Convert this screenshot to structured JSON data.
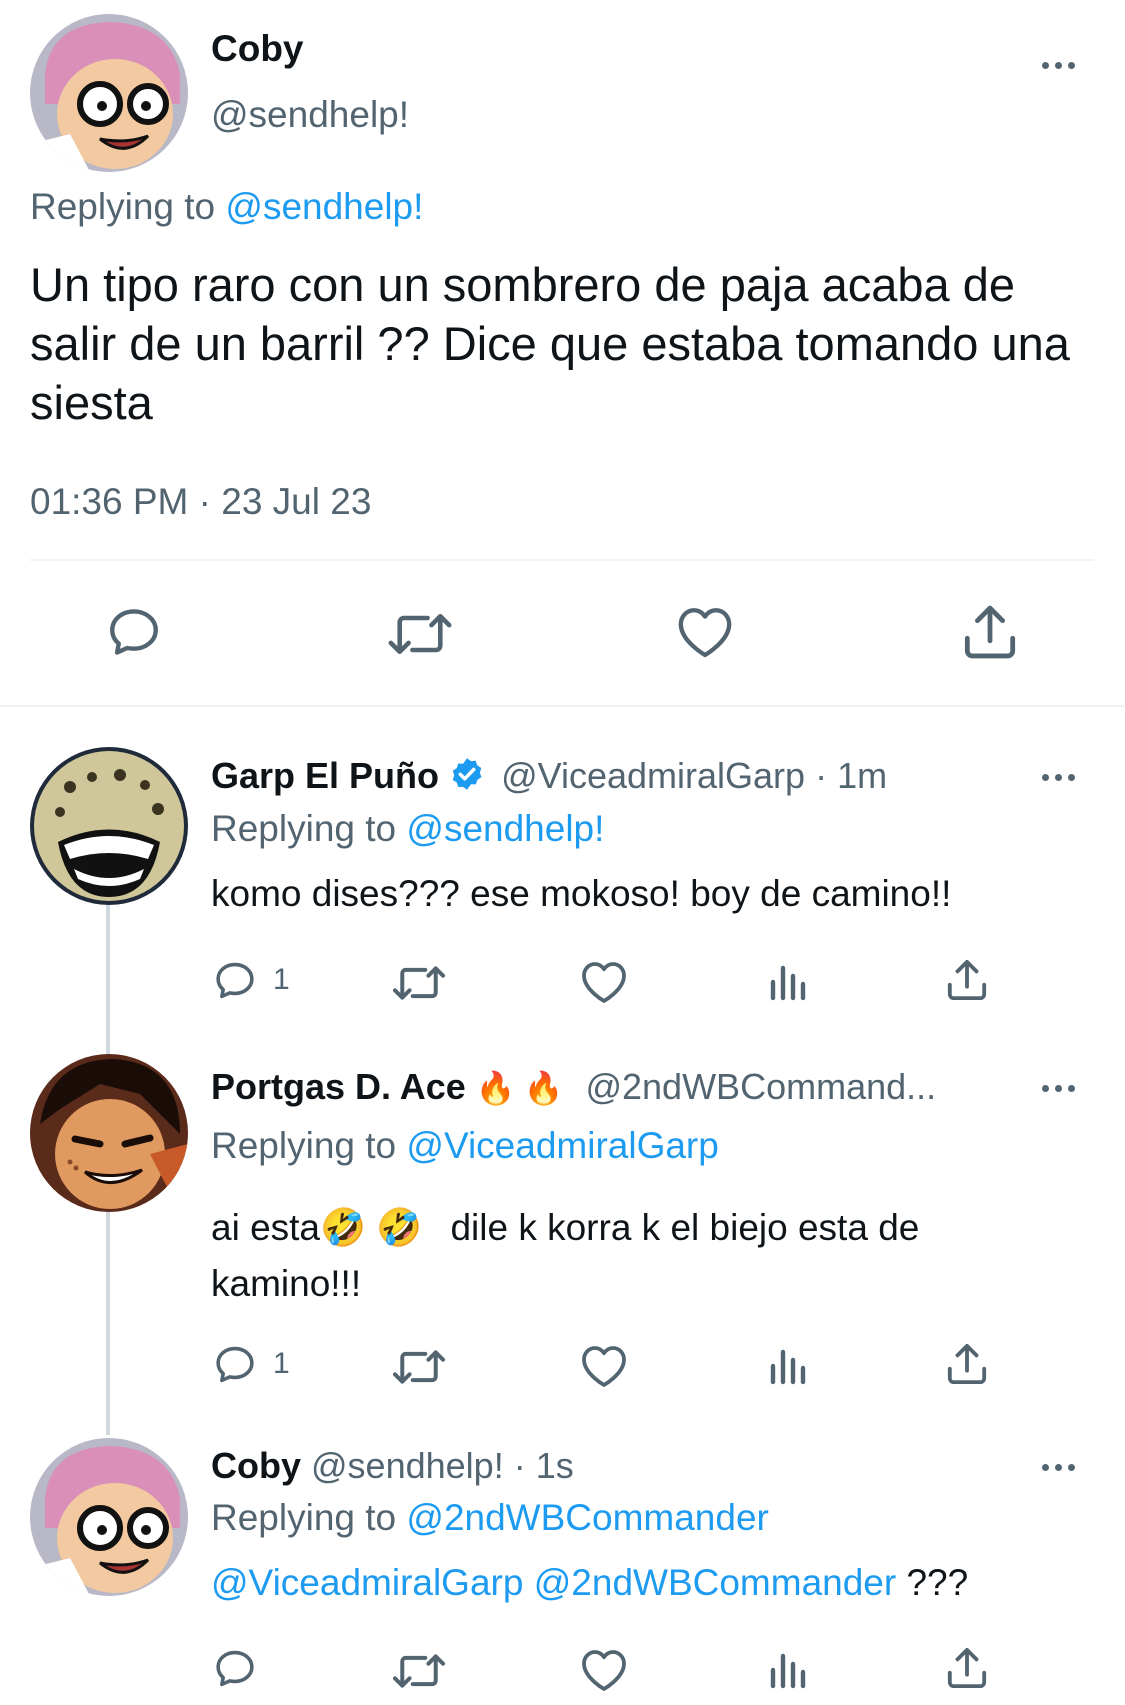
{
  "main_tweet": {
    "name": "Coby",
    "handle": "@sendhelp!",
    "replying_prefix": "Replying to",
    "replying_to": "@sendhelp!",
    "text": "Un tipo raro con un sombrero de paja acaba de salir de un barril ?? Dice que estaba tomando una siesta",
    "timestamp": "01:36 PM · 23 Jul 23"
  },
  "replies": [
    {
      "name": "Garp El Puño",
      "verified": true,
      "handle": "@ViceadmiralGarp",
      "time": "· 1m",
      "replying_prefix": "Replying to",
      "replying_to": "@sendhelp!",
      "text": "komo dises??? ese mokoso! boy de camino!!",
      "reply_count": "1"
    },
    {
      "name": "Portgas D. Ace",
      "name_emojis": "🔥🔥",
      "handle": "@2ndWBCommand...",
      "replying_prefix": "Replying to",
      "replying_to": "@ViceadmiralGarp",
      "text_a": "ai esta",
      "text_emojis": "🤣🤣",
      "text_b": "dile k korra k el biejo esta de",
      "text_c": "kamino!!!",
      "reply_count": "1"
    },
    {
      "name": "Coby",
      "handle": "@sendhelp!",
      "time": "· 1s",
      "replying_prefix": "Replying to",
      "replying_to": "@2ndWBCommander",
      "mention_1": "@ViceadmiralGarp",
      "mention_2": "@2ndWBCommander",
      "text_tail": "???"
    }
  ],
  "icons": [
    "reply-icon",
    "retweet-icon",
    "like-icon",
    "views-icon",
    "share-icon",
    "more-icon",
    "verified-badge-icon"
  ],
  "colors": {
    "accent": "#1d9bf0",
    "text": "#0f1419",
    "secondary": "#536471",
    "divider": "#eff3f4"
  }
}
